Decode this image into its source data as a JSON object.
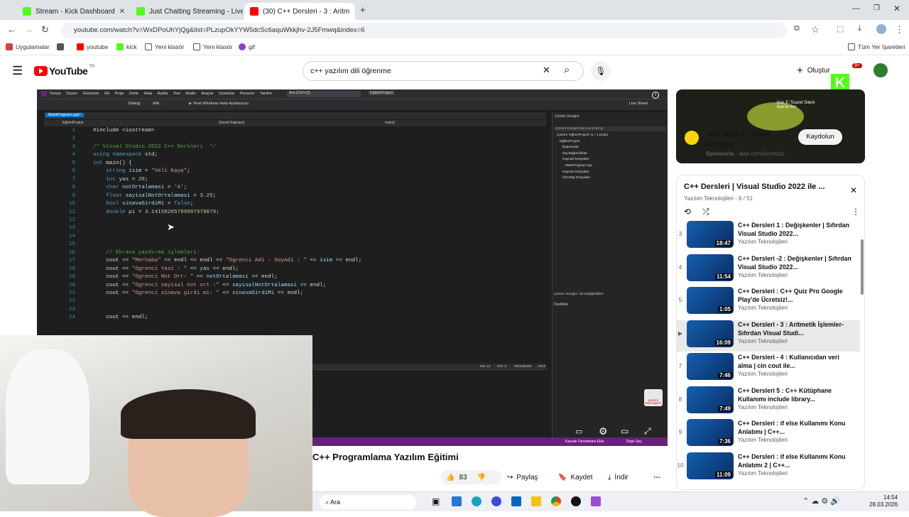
{
  "browser": {
    "tabs": [
      {
        "title": "Stream - Kick Dashboard",
        "active": false
      },
      {
        "title": "Just Chatting Streaming - Live",
        "active": false
      },
      {
        "title": "(30) C++ Dersleri - 3 : Aritm",
        "active": true
      }
    ],
    "url": "youtube.com/watch?v=WxDPoUhYjQg&list=PLzupOkYYW5dcSc6aquWkkjhv-2J5Fmwq&index=6",
    "bookmarks": [
      "Uygulamalar",
      "youtube",
      "kick",
      "Yeni klasör",
      "Yeni klasör",
      "gif"
    ],
    "all_bookmarks": "Tüm Yer İşaretleri"
  },
  "youtube": {
    "logo": "YouTube",
    "region": "TR",
    "search_value": "c++ yazılım dili öğrenme",
    "create_label": "Oluştur",
    "notif_count": "9+"
  },
  "video": {
    "vs_menu": [
      "Dosya",
      "Düzen",
      "Görünüm",
      "Git",
      "Proje",
      "Derle",
      "Hata Ayıkla",
      "Test",
      "Analiz",
      "Araçlar",
      "Uzantılar",
      "Pencere",
      "Yardım"
    ],
    "vs_search": "Ara (Ctrl+Q)",
    "vs_project": "EğitimProjesi",
    "vs_config": "Debug",
    "vs_platform": "x64",
    "vs_run": "Yerel Windows Hata Ayıklayıcısı",
    "vs_live_share": "Live Share",
    "file_tab": "MainProgram.cpp*",
    "scope_1": "EğitimProjesi",
    "scope_2": "(Genel Kapsam)",
    "scope_3": "main()",
    "code_lines": [
      {
        "n": "1",
        "html": "#include &lt;iostream&gt;"
      },
      {
        "n": "2",
        "html": ""
      },
      {
        "n": "3",
        "html": "<span class='cm'>/* Visual Studio 2022 C++ Dersleri  */</span>"
      },
      {
        "n": "4",
        "html": "<span class='kw'>using namespace</span> std;"
      },
      {
        "n": "5",
        "html": "<span class='kw'>int</span> main() {"
      },
      {
        "n": "6",
        "html": "    <span class='kw'>string</span> <span class='id'>isim</span> = <span class='str'>\"Veli Kaya\"</span>;"
      },
      {
        "n": "7",
        "html": "    <span class='kw'>int</span> <span class='id'>yas</span> = <span class='num'>20</span>;"
      },
      {
        "n": "8",
        "html": "    <span class='kw'>char</span> <span class='id'>notOrtalamasi</span> = <span class='str'>'A'</span>;"
      },
      {
        "n": "9",
        "html": "    <span class='kw'>float</span> <span class='id'>sayisalNotOrtalamasi</span> = <span class='num'>3.25</span>;"
      },
      {
        "n": "10",
        "html": "    <span class='kw'>bool</span> <span class='id'>sinavaGirdiMi</span> = <span class='kw'>false</span>;"
      },
      {
        "n": "11",
        "html": "    <span class='kw'>double</span> <span class='id'>pi</span> = <span class='num'>3.14159265789987979879</span>;"
      },
      {
        "n": "12",
        "html": ""
      },
      {
        "n": "13",
        "html": ""
      },
      {
        "n": "14",
        "html": ""
      },
      {
        "n": "15",
        "html": ""
      },
      {
        "n": "16",
        "html": "    <span class='cm'>// Ekrana yazdırma işlemleri:</span>"
      },
      {
        "n": "17",
        "html": "    cout &lt;&lt; <span class='str'>\"Merhaba\"</span> &lt;&lt; endl &lt;&lt; endl &lt;&lt; <span class='str'>\"Ogrenci Adi - Soyadi : \"</span> &lt;&lt; <span class='id'>isim</span> &lt;&lt; endl;"
      },
      {
        "n": "18",
        "html": "    cout &lt;&lt; <span class='str'>\"Ogrenci Yasi : \"</span> &lt;&lt; <span class='id'>yas</span> &lt;&lt; endl;"
      },
      {
        "n": "19",
        "html": "    cout &lt;&lt; <span class='str'>\"Ogrenci Not Ort: \"</span> &lt;&lt; <span class='id'>notOrtalamasi</span> &lt;&lt; endl;"
      },
      {
        "n": "20",
        "html": "    cout &lt;&lt; <span class='str'>\"Ogrenci sayisal not ort :\"</span> &lt;&lt; <span class='id'>sayisalNotOrtalamasi</span> &lt;&lt; endl;"
      },
      {
        "n": "21",
        "html": "    cout &lt;&lt; <span class='str'>\"Ogrenci sinava girdi mi: \"</span> &lt;&lt; <span class='id'>sinavaGirdiMi</span> &lt;&lt; endl;"
      },
      {
        "n": "22",
        "html": ""
      },
      {
        "n": "23",
        "html": ""
      },
      {
        "n": "24",
        "html": "    cout &lt;&lt; endl;"
      }
    ],
    "solution_title": "Çözüm Gezgini",
    "solution_search": "Çözüm Gezgini'nde Ara (Ctrl+ş)",
    "solution_items": [
      "Çözüm 'EğitimProjesi' (1 / 1 proje)",
      "EğitimProjesi",
      "Başvurular",
      "Dış Bağımlılıklar",
      "Kaynak Dosyaları",
      "MainProgram.cpp",
      "Kaynak Dosyaları",
      "Üst Bilgi Dosyaları"
    ],
    "solution_tabs": [
      "Çözüm Gezgini",
      "Git Değişiklikleri"
    ],
    "properties_title": "Özellikler",
    "status_line": "Sat: 13",
    "status_col": "Krkt: 5",
    "status_ws": "SEKMELER",
    "status_eol": "CRLF",
    "status_bottom_left": "Kaynak Denetimine Ekle",
    "status_bottom_right": "Depo Seç",
    "watermark": "yazılım teknolojileri"
  },
  "title": "C++ Programlama Yazılım Eğitimi",
  "actions": {
    "likes": "83",
    "share": "Paylaş",
    "save": "Kaydet",
    "download": "İndir"
  },
  "ad": {
    "banner_text": "ikas E-Ticaret Siteni ikas'la Kur",
    "title": "Yeni Nesil E Ticaret Altyapısı",
    "sponsor": "Sponsorlu",
    "domain": "ikas.com/ücretsiz/...",
    "cta": "Kaydolun"
  },
  "playlist": {
    "title": "C++ Dersleri | Visual Studio 2022 ile ...",
    "channel_count": "Yazılım Teknolojileri - 6 / 51",
    "items": [
      {
        "idx": "3",
        "title": "C++ Dersleri 1 : Değişkenler | Sıfırdan Visual Studio 2022...",
        "channel": "Yazılım Teknolojileri",
        "dur": "18:47",
        "current": false
      },
      {
        "idx": "4",
        "title": "C++ Dersleri -2 : Değişkenler | Sıfırdan Visual Studio 2022...",
        "channel": "Yazılım Teknolojileri",
        "dur": "11:54",
        "current": false
      },
      {
        "idx": "5",
        "title": "C++ Dersleri : C++ Quiz Pro Google Play'de Ücretsiz!...",
        "channel": "Yazılım Teknolojileri",
        "dur": "1:05",
        "current": false
      },
      {
        "idx": "▶",
        "title": "C++ Dersleri - 3 : Aritmetik İşlemler- Sıfırdan Visual Studi...",
        "channel": "Yazılım Teknolojileri",
        "dur": "16:09",
        "current": true
      },
      {
        "idx": "7",
        "title": "C++ Dersleri - 4 : Kullanıcıdan veri alma | cin cout ile...",
        "channel": "Yazılım Teknolojileri",
        "dur": "7:46",
        "current": false
      },
      {
        "idx": "8",
        "title": "C++ Dersleri 5 : C++ Kütüphane Kullanımı include library...",
        "channel": "Yazılım Teknolojileri",
        "dur": "7:49",
        "current": false
      },
      {
        "idx": "9",
        "title": "C++ Dersleri : if else Kullanımı Konu Anlatımı | C++...",
        "channel": "Yazılım Teknolojileri",
        "dur": "7:36",
        "current": false
      },
      {
        "idx": "10",
        "title": "C++ Dersleri : if else Kullanımı Konu Anlatımı 2 | C++...",
        "channel": "Yazılım Teknolojileri",
        "dur": "11:09",
        "current": false
      }
    ]
  },
  "taskbar": {
    "search": "Ara",
    "time": "14:54",
    "date": "28.03.2026"
  },
  "colors": {
    "yt_red": "#ff0000",
    "vs_bg": "#1e1e1e",
    "vs_purple": "#68217a",
    "kick_green": "#53fc18"
  }
}
